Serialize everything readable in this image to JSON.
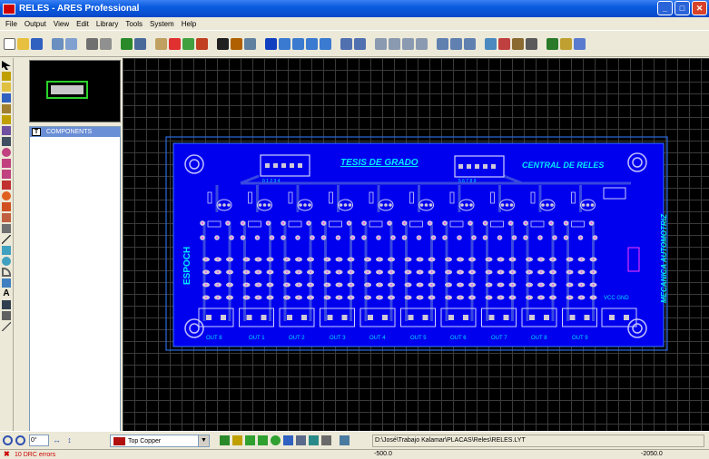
{
  "window": {
    "title": "RELES - ARES Professional"
  },
  "menu": [
    "File",
    "Output",
    "View",
    "Edit",
    "Library",
    "Tools",
    "System",
    "Help"
  ],
  "selector": {
    "toggle": "T",
    "header": "COMPONENTS"
  },
  "board": {
    "title": "TESIS DE GRADO",
    "subtitle": "CENTRAL DE RELES",
    "left_label": "ESPOCH",
    "right_label": "MECANICA AUTOMOTRIZ",
    "vcc_label": "VCC GND",
    "connector_left_pins": "0 1 2 3 4",
    "connector_right_pins": "5 6 7 8 9",
    "outputs": [
      "OUT 8",
      "OUT 1",
      "OUT 2",
      "OUT 3",
      "OUT 4",
      "OUT 5",
      "OUT 6",
      "OUT 7",
      "OUT 8",
      "OUT 9"
    ]
  },
  "bottom": {
    "angle": "0°",
    "layer": "Top Copper",
    "path": "D:\\José\\Trabajo Kalamar\\PLACAS\\Reles\\RELES.LYT"
  },
  "status": {
    "drc": "10 DRC errors",
    "x": "-500.0",
    "y": "-2050.0"
  },
  "colors": {
    "board": "#0000ff",
    "trace": "#2a3bd8",
    "pad": "#d0c8d8",
    "silk": "#00e0ff",
    "grid": "#3a3a3a",
    "outline": "#2bd22b"
  }
}
